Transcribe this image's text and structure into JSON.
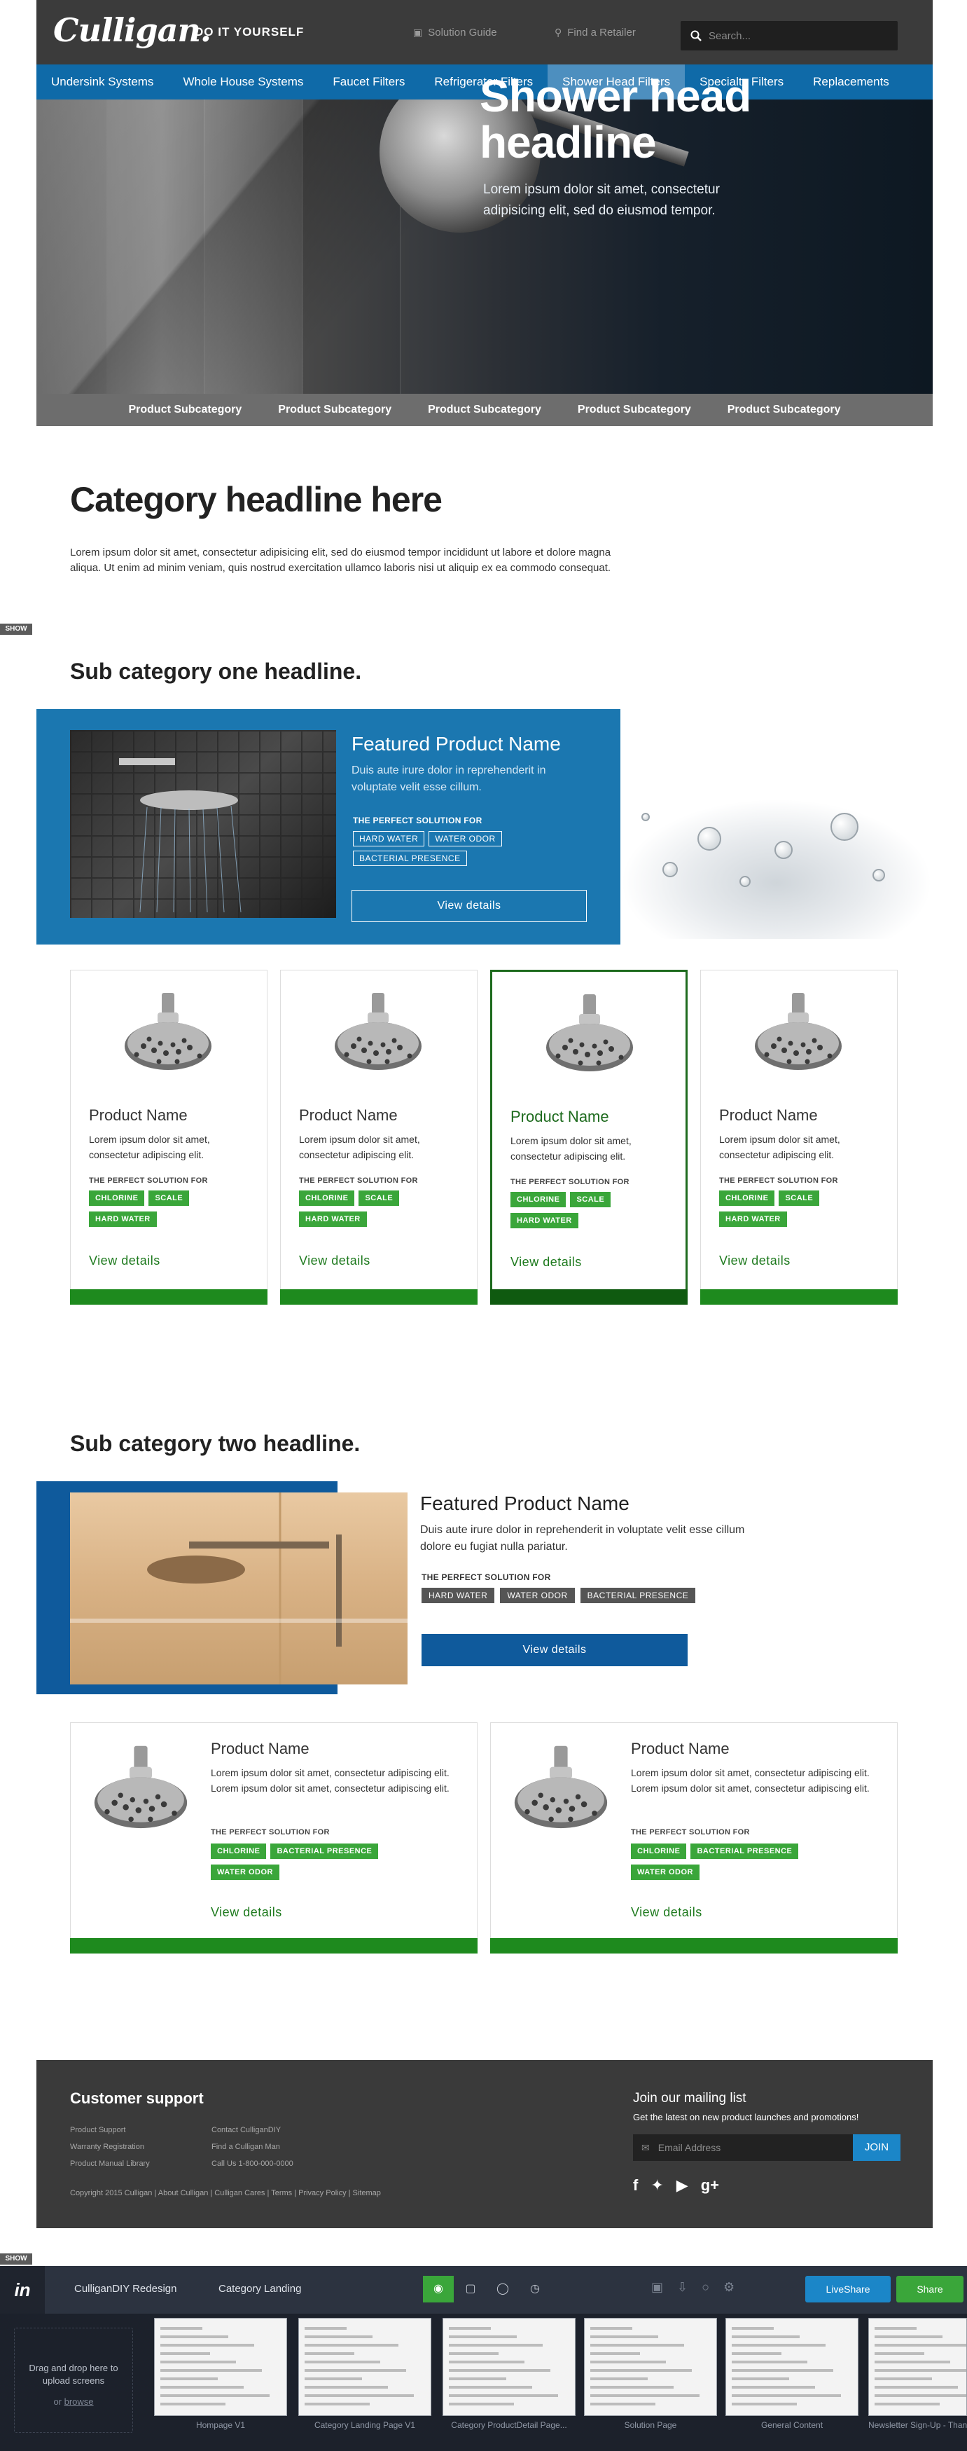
{
  "header": {
    "logo": "Culligan.",
    "tagline": "DO IT YOURSELF",
    "solution_guide": "Solution Guide",
    "find_retailer": "Find a Retailer",
    "search_placeholder": "Search..."
  },
  "nav": {
    "items": [
      "Undersink Systems",
      "Whole House Systems",
      "Faucet Filters",
      "Refrigerator Filters",
      "Shower Head Filters",
      "Specialty Filters",
      "Replacements"
    ],
    "active": "Shower Head Filters"
  },
  "hero": {
    "title_line1": "Shower head",
    "title_line2": "headline",
    "subtitle": "Lorem ipsum dolor sit amet, consectetur adipisicing elit, sed do eiusmod tempor."
  },
  "subcategories": [
    "Product Subcategory",
    "Product Subcategory",
    "Product Subcategory",
    "Product Subcategory",
    "Product Subcategory"
  ],
  "category": {
    "headline": "Category headline here",
    "intro": "Lorem ipsum dolor sit amet, consectetur adipisicing elit, sed do eiusmod tempor incididunt ut labore et dolore magna aliqua. Ut enim ad minim veniam, quis nostrud exercitation ullamco laboris nisi ut aliquip ex ea commodo consequat."
  },
  "show_label": "SHOW",
  "sub1": {
    "headline": "Sub category one headline.",
    "featured": {
      "name": "Featured Product Name",
      "desc": "Duis aute irure dolor in reprehenderit in voluptate velit esse cillum.",
      "solution_label": "THE PERFECT SOLUTION FOR",
      "tags": [
        "HARD WATER",
        "WATER ODOR",
        "BACTERIAL PRESENCE"
      ],
      "button": "View details"
    },
    "products": [
      {
        "name": "Product Name",
        "desc": "Lorem ipsum dolor sit amet, consectetur adipiscing elit.",
        "solution_label": "THE PERFECT SOLUTION FOR",
        "tags": [
          "CHLORINE",
          "SCALE",
          "HARD WATER"
        ],
        "link": "View details"
      },
      {
        "name": "Product Name",
        "desc": "Lorem ipsum dolor sit amet, consectetur adipiscing elit.",
        "solution_label": "THE PERFECT SOLUTION FOR",
        "tags": [
          "CHLORINE",
          "SCALE",
          "HARD WATER"
        ],
        "link": "View details"
      },
      {
        "name": "Product Name",
        "desc": "Lorem ipsum dolor sit amet, consectetur adipiscing elit.",
        "solution_label": "THE PERFECT SOLUTION FOR",
        "tags": [
          "CHLORINE",
          "SCALE",
          "HARD WATER"
        ],
        "link": "View details"
      },
      {
        "name": "Product Name",
        "desc": "Lorem ipsum dolor sit amet, consectetur adipiscing elit.",
        "solution_label": "THE PERFECT SOLUTION FOR",
        "tags": [
          "CHLORINE",
          "SCALE",
          "HARD WATER"
        ],
        "link": "View details"
      }
    ]
  },
  "sub2": {
    "headline": "Sub category two headline.",
    "featured": {
      "name": "Featured Product Name",
      "desc": "Duis aute irure dolor in reprehenderit in voluptate velit esse cillum dolore eu fugiat nulla pariatur.",
      "solution_label": "THE PERFECT SOLUTION FOR",
      "tags": [
        "HARD WATER",
        "WATER ODOR",
        "BACTERIAL PRESENCE"
      ],
      "button": "View details"
    },
    "products": [
      {
        "name": "Product Name",
        "desc": "Lorem ipsum dolor sit amet, consectetur adipiscing elit. Lorem ipsum dolor sit amet, consectetur adipiscing elit.",
        "solution_label": "THE PERFECT SOLUTION FOR",
        "tags": [
          "CHLORINE",
          "BACTERIAL PRESENCE",
          "WATER ODOR"
        ],
        "link": "View details"
      },
      {
        "name": "Product Name",
        "desc": "Lorem ipsum dolor sit amet, consectetur adipiscing elit. Lorem ipsum dolor sit amet, consectetur adipiscing elit.",
        "solution_label": "THE PERFECT SOLUTION FOR",
        "tags": [
          "CHLORINE",
          "BACTERIAL PRESENCE",
          "WATER ODOR"
        ],
        "link": "View details"
      }
    ]
  },
  "footer": {
    "title": "Customer support",
    "col1": [
      "Product Support",
      "Warranty Registration",
      "Product Manual Library"
    ],
    "col2": [
      "Contact CulliganDIY",
      "Find a Culligan Man",
      "Call Us 1-800-000-0000"
    ],
    "legal": "Copyright 2015 Culligan  |  About Culligan  |  Culligan Cares  |  Terms  |  Privacy Policy  |  Sitemap",
    "mail_title": "Join our mailing list",
    "mail_sub": "Get the latest on new product launches and promotions!",
    "mail_placeholder": "Email Address",
    "mail_join": "JOIN",
    "social_icons": [
      "facebook-icon",
      "twitter-icon",
      "youtube-icon",
      "google-plus-icon"
    ]
  },
  "invision": {
    "logo": "in",
    "project": "CulliganDIY Redesign",
    "screen": "Category Landing",
    "liveshare": "LiveShare",
    "share": "Share",
    "drop_text": "Drag and drop here to upload screens",
    "drop_or": "or",
    "drop_link": "browse",
    "thumbs": [
      "Hompage V1",
      "Category Landing Page V1",
      "Category ProductDetail Page...",
      "Solution Page",
      "General Content",
      "Newsletter Sign-Up - Thank..."
    ],
    "colors": {
      "accent": "#3aa63a",
      "liveshare": "#1b86c8"
    }
  },
  "colors": {
    "nav_blue": "#0f6aa8",
    "brand_green": "#1e8a1e",
    "tag_green": "#3aa63a",
    "dark": "#3a3a3a"
  }
}
